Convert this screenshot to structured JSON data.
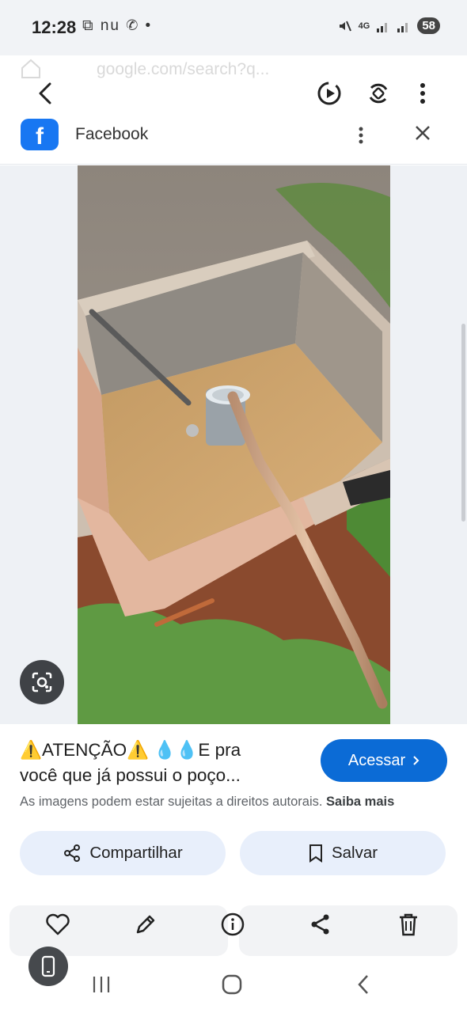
{
  "status_bar": {
    "time": "12:28",
    "notif_icons": "⧉ nu ✆ •",
    "network": "4G",
    "battery": "58"
  },
  "ghost_browser": {
    "url": "google.com/search?q..."
  },
  "source": {
    "name": "Facebook"
  },
  "result": {
    "title_line1": "⚠️ATENÇÃO⚠️ 💧💧E pra",
    "title_line2": "você que já possui o poço...",
    "access_label": "Acessar",
    "copyright_text": "As imagens podem estar sujeitas a direitos autorais.",
    "learn_more": "Saiba mais",
    "share_label": "Compartilhar",
    "save_label": "Salvar"
  },
  "colors": {
    "accent": "#0b6bd6",
    "pill_bg": "#e8effb",
    "facebook": "#1877f2"
  },
  "icons": {
    "toolbar": [
      "back-icon",
      "motion-icon",
      "rotate-icon",
      "more-vert-icon"
    ],
    "actions": [
      "heart-icon",
      "pencil-icon",
      "info-icon",
      "share-icon",
      "trash-icon"
    ],
    "nav": [
      "recents-icon",
      "home-icon",
      "back-nav-icon"
    ]
  }
}
